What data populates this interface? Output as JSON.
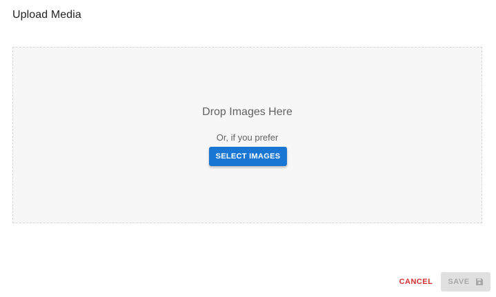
{
  "dialog": {
    "title": "Upload Media"
  },
  "dropzone": {
    "title": "Drop Images Here",
    "subtitle": "Or, if you prefer",
    "select_label": "SELECT IMAGES"
  },
  "actions": {
    "cancel_label": "CANCEL",
    "save_label": "SAVE",
    "save_icon": "floppy-disk-icon",
    "save_disabled": true
  },
  "colors": {
    "primary": "#1976d2",
    "danger": "#d32f2f",
    "disabled_bg": "#e0e0e0",
    "disabled_text": "#a8a8a8"
  }
}
